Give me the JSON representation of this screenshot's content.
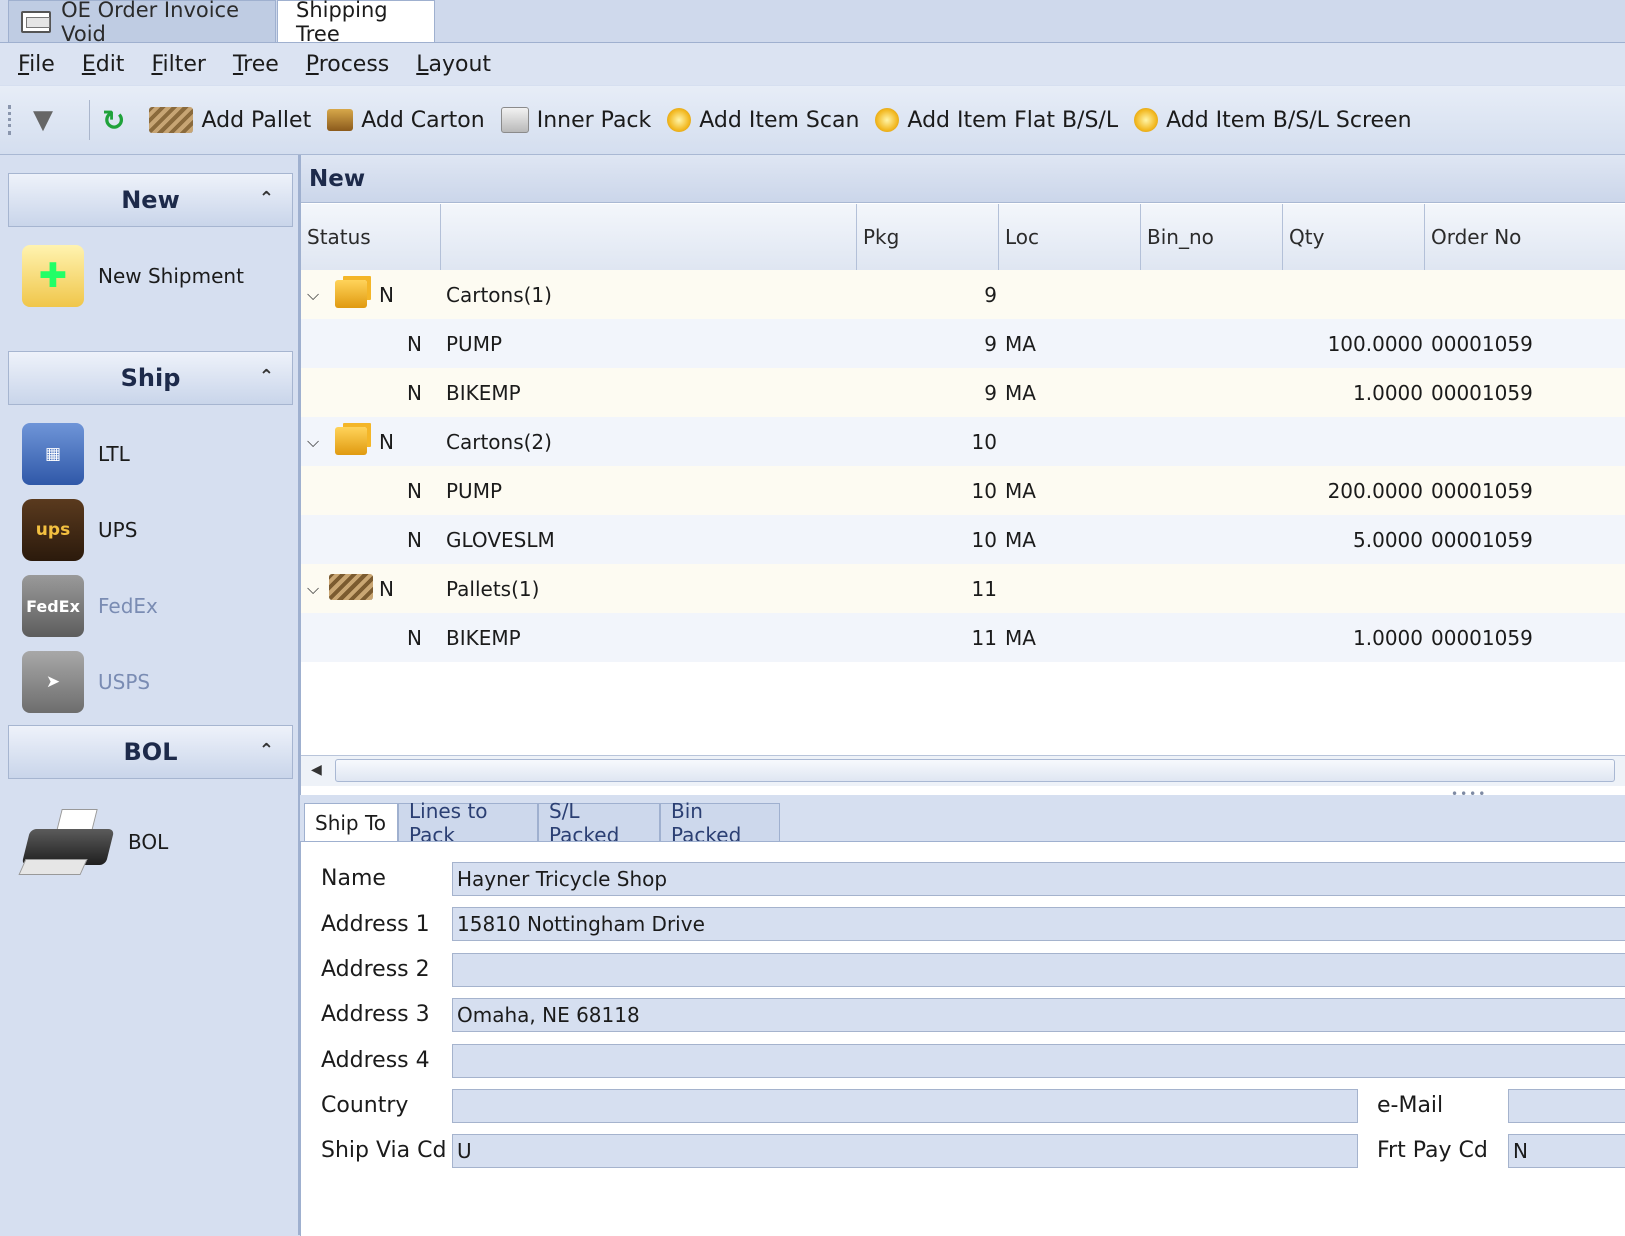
{
  "doc_tabs": [
    {
      "label": "OE Order Invoice Void"
    },
    {
      "label": "Shipping Tree"
    }
  ],
  "menu": [
    "File",
    "Edit",
    "Filter",
    "Tree",
    "Process",
    "Layout"
  ],
  "toolbar": {
    "add_pallet": "Add Pallet",
    "add_carton": "Add Carton",
    "inner_pack": "Inner Pack",
    "add_item_scan": "Add Item Scan",
    "add_item_flat": "Add Item Flat B/S/L",
    "add_item_screen": "Add Item B/S/L Screen"
  },
  "nav": {
    "new_header": "New",
    "new_shipment": "New Shipment",
    "ship_header": "Ship",
    "ltl": "LTL",
    "ups": "UPS",
    "ups_tile": "ups",
    "fedex": "FedEx",
    "fedex_tile": "FedEx",
    "usps": "USPS",
    "bol_header": "BOL",
    "bol": "BOL"
  },
  "grid": {
    "title": "New",
    "columns": [
      "Status",
      "",
      "Pkg",
      "Loc",
      "Bin_no",
      "Qty",
      "Order No"
    ],
    "rows": [
      {
        "level": 0,
        "kind": "cartons",
        "status": "N",
        "name": "Cartons(1)",
        "pkg": "9",
        "loc": "",
        "bin": "",
        "qty": "",
        "order": ""
      },
      {
        "level": 1,
        "status": "N",
        "name": "PUMP",
        "pkg": "9",
        "loc": "MA",
        "bin": "",
        "qty": "100.0000",
        "order": "00001059"
      },
      {
        "level": 1,
        "status": "N",
        "name": "BIKEMP",
        "pkg": "9",
        "loc": "MA",
        "bin": "",
        "qty": "1.0000",
        "order": "00001059"
      },
      {
        "level": 0,
        "kind": "cartons",
        "status": "N",
        "name": "Cartons(2)",
        "pkg": "10",
        "loc": "",
        "bin": "",
        "qty": "",
        "order": ""
      },
      {
        "level": 1,
        "status": "N",
        "name": "PUMP",
        "pkg": "10",
        "loc": "MA",
        "bin": "",
        "qty": "200.0000",
        "order": "00001059"
      },
      {
        "level": 1,
        "status": "N",
        "name": "GLOVESLM",
        "pkg": "10",
        "loc": "MA",
        "bin": "",
        "qty": "5.0000",
        "order": "00001059"
      },
      {
        "level": 0,
        "kind": "pallets",
        "status": "N",
        "name": "Pallets(1)",
        "pkg": "11",
        "loc": "",
        "bin": "",
        "qty": "",
        "order": ""
      },
      {
        "level": 1,
        "status": "N",
        "name": "BIKEMP",
        "pkg": "11",
        "loc": "MA",
        "bin": "",
        "qty": "1.0000",
        "order": "00001059"
      }
    ]
  },
  "sub_tabs": [
    "Ship To",
    "Lines to Pack",
    "S/L Packed",
    "Bin Packed"
  ],
  "form": {
    "name_label": "Name",
    "name": "Hayner Tricycle Shop",
    "addr1_label": "Address 1",
    "addr1": "15810 Nottingham Drive",
    "addr2_label": "Address 2",
    "addr2": "",
    "addr3_label": "Address 3",
    "addr3": "Omaha, NE 68118",
    "addr4_label": "Address 4",
    "addr4": "",
    "country_label": "Country",
    "country": "",
    "email_label": "e-Mail",
    "email": "",
    "shipvia_label": "Ship Via Cd",
    "shipvia": "U",
    "frtpay_label": "Frt Pay Cd",
    "frtpay": "N"
  }
}
